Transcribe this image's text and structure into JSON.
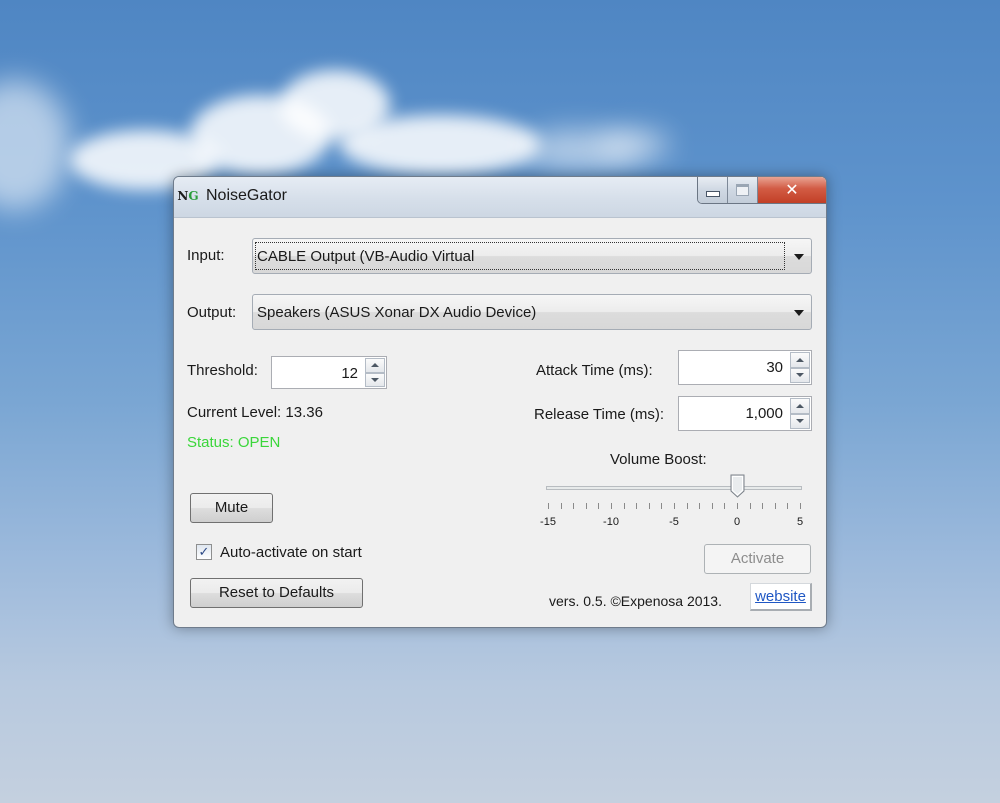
{
  "window": {
    "title": "NoiseGator",
    "icon_text_n": "N",
    "icon_text_g": "G",
    "close_glyph": "✕"
  },
  "input": {
    "label": "Input:",
    "value": "CABLE Output (VB-Audio Virtual"
  },
  "output": {
    "label": "Output:",
    "value": "Speakers (ASUS Xonar DX Audio Device)"
  },
  "threshold": {
    "label": "Threshold:",
    "value": "12"
  },
  "attack_time": {
    "label": "Attack Time (ms):",
    "value": "30"
  },
  "release_time": {
    "label": "Release Time (ms):",
    "value": "1,000"
  },
  "current_level": {
    "text": "Current Level: 13.36"
  },
  "status": {
    "text": "Status: OPEN",
    "color": "#3ad63a"
  },
  "volume_boost": {
    "label": "Volume Boost:",
    "value": 0,
    "min": -15,
    "max": 5,
    "tick_labels": [
      "-15",
      "-10",
      "-5",
      "0",
      "5"
    ]
  },
  "buttons": {
    "mute": "Mute",
    "reset": "Reset to Defaults",
    "activate": "Activate"
  },
  "auto_activate": {
    "label": "Auto-activate on start",
    "checked": true,
    "check_glyph": "✓"
  },
  "footer": {
    "version": "vers. 0.5. ©Expenosa 2013.",
    "link": "website"
  }
}
